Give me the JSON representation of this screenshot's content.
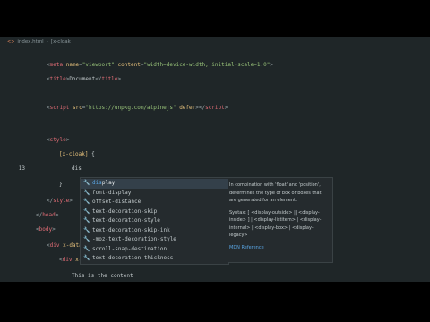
{
  "breadcrumb": {
    "file": "index.html",
    "sep": "›",
    "item": "[x-cloak"
  },
  "code_lines": [
    {
      "num": "",
      "segs": [
        {
          "c": "punct",
          "t": "<"
        },
        {
          "c": "tag",
          "t": "meta"
        },
        {
          "c": "txt",
          "t": " "
        },
        {
          "c": "attr",
          "t": "name"
        },
        {
          "c": "punct",
          "t": "="
        },
        {
          "c": "str",
          "t": "\"viewport\""
        },
        {
          "c": "txt",
          "t": " "
        },
        {
          "c": "attr",
          "t": "content"
        },
        {
          "c": "punct",
          "t": "="
        },
        {
          "c": "str",
          "t": "\"width=device-width, initial-scale=1.0\""
        },
        {
          "c": "punct",
          "t": ">"
        }
      ]
    },
    {
      "num": "",
      "segs": [
        {
          "c": "punct",
          "t": "<"
        },
        {
          "c": "tag",
          "t": "title"
        },
        {
          "c": "punct",
          "t": ">"
        },
        {
          "c": "txt",
          "t": "Document"
        },
        {
          "c": "punct",
          "t": "</"
        },
        {
          "c": "tag",
          "t": "title"
        },
        {
          "c": "punct",
          "t": ">"
        }
      ]
    },
    {
      "num": "",
      "segs": [
        {
          "c": "punct",
          "t": "<"
        },
        {
          "c": "tag",
          "t": "script"
        },
        {
          "c": "txt",
          "t": " "
        },
        {
          "c": "attr",
          "t": "src"
        },
        {
          "c": "punct",
          "t": "="
        },
        {
          "c": "str",
          "t": "\"https://unpkg.com/alpinejs\""
        },
        {
          "c": "txt",
          "t": " "
        },
        {
          "c": "attr",
          "t": "defer"
        },
        {
          "c": "punct",
          "t": "></"
        },
        {
          "c": "tag",
          "t": "script"
        },
        {
          "c": "punct",
          "t": ">"
        }
      ]
    },
    {
      "num": "",
      "segs": [
        {
          "c": "punct",
          "t": "<"
        },
        {
          "c": "tag",
          "t": "style"
        },
        {
          "c": "punct",
          "t": ">"
        }
      ]
    },
    {
      "num": "",
      "segs": [
        {
          "c": "sel",
          "t": "[x-cloak]"
        },
        {
          "c": "txt",
          "t": " {"
        }
      ]
    },
    {
      "num": "13",
      "segs": [
        {
          "c": "txt",
          "t": "dis"
        }
      ]
    },
    {
      "num": "",
      "segs": [
        {
          "c": "txt",
          "t": "}"
        }
      ]
    },
    {
      "num": "",
      "segs": [
        {
          "c": "punct",
          "t": "</"
        },
        {
          "c": "tag",
          "t": "style"
        },
        {
          "c": "punct",
          "t": ">"
        }
      ]
    },
    {
      "num": "",
      "segs": [
        {
          "c": "punct",
          "t": "</"
        },
        {
          "c": "tag",
          "t": "head"
        },
        {
          "c": "punct",
          "t": ">"
        }
      ]
    },
    {
      "num": "",
      "segs": [
        {
          "c": "punct",
          "t": "<"
        },
        {
          "c": "tag",
          "t": "body"
        },
        {
          "c": "punct",
          "t": ">"
        }
      ]
    },
    {
      "num": "",
      "segs": [
        {
          "c": "punct",
          "t": "<"
        },
        {
          "c": "tag",
          "t": "div"
        },
        {
          "c": "txt",
          "t": " "
        },
        {
          "c": "attr",
          "t": "x-data"
        }
      ]
    },
    {
      "num": "",
      "segs": [
        {
          "c": "punct",
          "t": "<"
        },
        {
          "c": "tag",
          "t": "div"
        },
        {
          "c": "txt",
          "t": " "
        },
        {
          "c": "attr",
          "t": "x-"
        }
      ]
    },
    {
      "num": "",
      "segs": [
        {
          "c": "txt",
          "t": "This is the content"
        }
      ]
    }
  ],
  "suggestions": [
    {
      "match": "dis",
      "rest": "play",
      "selected": true
    },
    {
      "match": "",
      "rest": "font-display",
      "selected": false
    },
    {
      "match": "",
      "rest": "offset-distance",
      "selected": false
    },
    {
      "match": "",
      "rest": "text-decoration-skip",
      "selected": false
    },
    {
      "match": "",
      "rest": "text-decoration-style",
      "selected": false
    },
    {
      "match": "",
      "rest": "text-decoration-skip-ink",
      "selected": false
    },
    {
      "match": "",
      "rest": "-moz-text-decoration-style",
      "selected": false
    },
    {
      "match": "",
      "rest": "scroll-snap-destination",
      "selected": false
    },
    {
      "match": "",
      "rest": "text-decoration-thickness",
      "selected": false
    }
  ],
  "docs": {
    "description": "In combination with 'float' and 'position', determines the type of box or boxes that are generated for an element.",
    "syntax": "Syntax: [ <display-outside> || <display-inside> ] | <display-listitem> | <display-internal> | <display-box> | <display-legacy>",
    "link": "MDN Reference"
  }
}
